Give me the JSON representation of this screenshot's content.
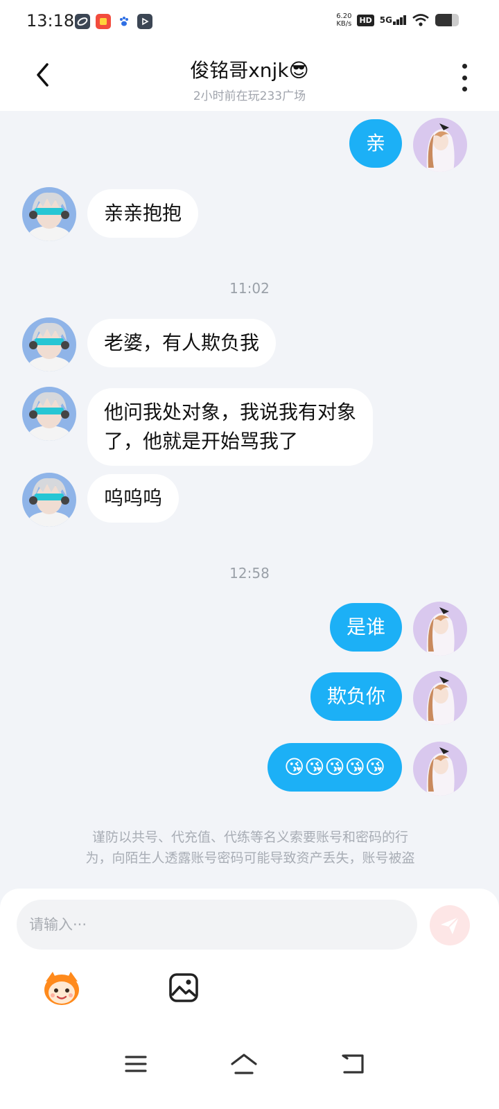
{
  "status_bar": {
    "time": "13:18",
    "net_speed_value": "6.20",
    "net_speed_unit": "KB/s",
    "hd_label": "HD",
    "network_label": "5G",
    "battery_level": 0.7
  },
  "header": {
    "title": "俊铭哥xnjk😎",
    "subtitle": "2小时前在玩233广场"
  },
  "messages": [
    {
      "direction": "out",
      "text": "亲"
    },
    {
      "direction": "in",
      "text": "亲亲抱抱"
    },
    {
      "type": "time",
      "text": "11:02"
    },
    {
      "direction": "in",
      "text": "老婆，有人欺负我"
    },
    {
      "direction": "in",
      "line1": "他问我处对象，我说我有对象",
      "line2": "了，他就是开始骂我了"
    },
    {
      "direction": "in",
      "text": "呜呜呜"
    },
    {
      "type": "time",
      "text": "12:58"
    },
    {
      "direction": "out",
      "text": "是谁"
    },
    {
      "direction": "out",
      "text": "欺负你"
    },
    {
      "direction": "out",
      "text": "😘😘😘😘😘"
    }
  ],
  "notice": {
    "line1": "谨防以共号、代充值、代练等名义索要账号和密码的行",
    "line2": "为，向陌生人透露账号密码可能导致资产丢失，账号被盗"
  },
  "composer": {
    "placeholder": "请输入···",
    "value": ""
  },
  "icons": {
    "back": "chevron-left-icon",
    "more": "more-vertical-icon",
    "send": "paper-plane-icon",
    "emoji": "mascot-emoji-icon",
    "image": "image-icon",
    "nav_menu": "menu-icon",
    "nav_home": "home-icon",
    "nav_back": "back-arrow-icon"
  },
  "colors": {
    "outgoing_bubble": "#1cb0f6",
    "incoming_bubble": "#ffffff",
    "background": "#f2f4f8",
    "send_button": "#fde6e6"
  }
}
